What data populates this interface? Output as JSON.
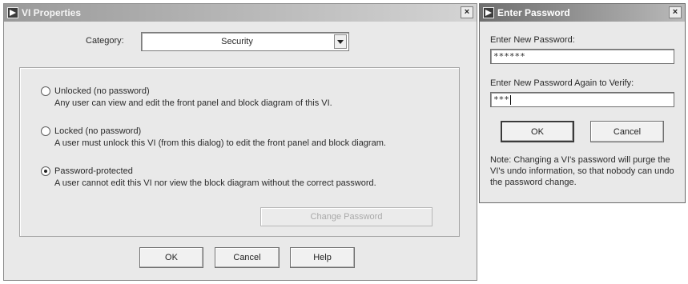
{
  "vi_properties": {
    "title": "VI Properties",
    "close_glyph": "×",
    "category_label": "Category:",
    "category_value": "Security",
    "options": [
      {
        "label": "Unlocked (no password)",
        "description": "Any user can view and edit the front panel and block diagram of this VI.",
        "selected": false
      },
      {
        "label": "Locked (no password)",
        "description": "A user must unlock this VI (from this dialog) to edit the front panel and block diagram.",
        "selected": false
      },
      {
        "label": "Password-protected",
        "description": "A user cannot edit this VI nor view the block diagram without the correct password.",
        "selected": true
      }
    ],
    "change_password_label": "Change Password",
    "ok_label": "OK",
    "cancel_label": "Cancel",
    "help_label": "Help"
  },
  "enter_password": {
    "title": "Enter Password",
    "close_glyph": "×",
    "new_password_label": "Enter New Password:",
    "new_password_value": "******",
    "verify_label": "Enter New Password Again to Verify:",
    "verify_value": "***",
    "ok_label": "OK",
    "cancel_label": "Cancel",
    "note": "Note:  Changing a VI's password will purge the VI's undo information, so that nobody can undo the password change."
  },
  "icons": {
    "app": "labview-run-arrow-icon",
    "close": "close-icon",
    "dropdown": "chevron-down-icon"
  },
  "colors": {
    "window_bg": "#e9e9e9",
    "title_gradient_start": "#6f6f6f",
    "title_text": "#ffffff"
  }
}
